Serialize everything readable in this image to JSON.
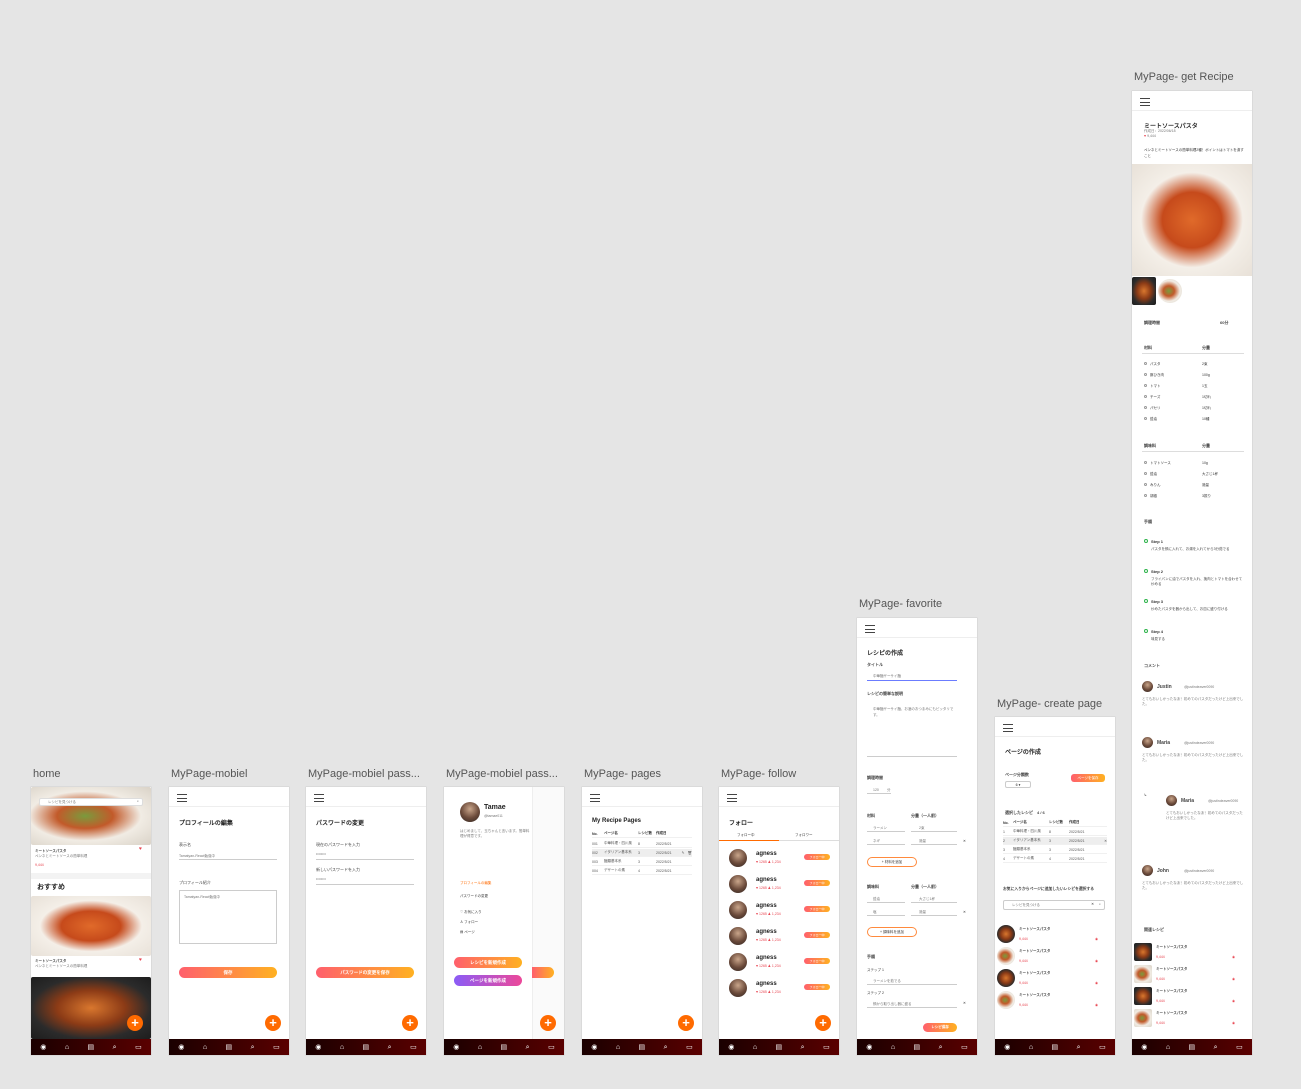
{
  "frames": {
    "home": {
      "label": "home",
      "search_placeholder": "レシピを見つける",
      "section_title": "おすすめ",
      "card_title": "ミートソースパスタ",
      "card_desc": "ペンネとミートソースの簡単料理",
      "likes": "9,444",
      "nav_icons": [
        "user-icon",
        "home-icon",
        "recipe-icon",
        "search-icon",
        "chat-icon"
      ]
    },
    "mobiel": {
      "label": "MyPage-mobiel",
      "title": "プロフィールの編集",
      "name_label": "表示名",
      "name_value": "Tamatyan-React勉強中",
      "bio_label": "プロフィール紹介",
      "bio_value": "Tamatyan-React勉強中",
      "save_label": "保存"
    },
    "password": {
      "label": "MyPage-mobiel pass...",
      "title": "パスワードの変更",
      "current_label": "現在のパスワードを入力",
      "new_label": "新しいパスワードを入力",
      "dots": "••••••••",
      "save_label": "パスワードの変更を保存"
    },
    "menu": {
      "label": "MyPage-mobiel pass...",
      "user_name": "Tamae",
      "user_id": "@tamae011",
      "bio": "はじめまして、玉ちゃんと言います。簡単料理が得意です。",
      "link_profile": "プロフィールの編集",
      "link_password": "パスワードの変更",
      "item_fav": "お気に入り",
      "item_follow": "フォロー",
      "item_page": "ページ",
      "btn_recipe": "レシピを新規作成",
      "btn_page": "ページを新規作成"
    },
    "pages": {
      "label": "MyPage- pages",
      "title": "My Recipe Pages",
      "headers": [
        "No.",
        "ページ名",
        "レシピ数",
        "作成日"
      ],
      "rows": [
        [
          "001",
          "中華料理・四川風",
          "8",
          "2022/5/21"
        ],
        [
          "002",
          "イタリアン基本系",
          "3",
          "2022/5/21"
        ],
        [
          "003",
          "麺類基本系",
          "3",
          "2022/5/21"
        ],
        [
          "004",
          "デザートの素",
          "4",
          "2022/5/21"
        ]
      ]
    },
    "follow": {
      "label": "MyPage- follow",
      "title": "フォロー",
      "tab_following": "フォロー中",
      "tab_followers": "フォロワー",
      "user": "agness",
      "stats": "♥ 1265  ♟ 1,234",
      "btn": "フォロー中",
      "count": 6
    },
    "favorite": {
      "label": "MyPage- favorite",
      "title": "レシピの作成",
      "title_label": "タイトル",
      "title_value": "中華麺ザーサイ麺",
      "desc_label": "レシピの簡単な説明",
      "desc_value": "中華麺ザーサイ麺、お酒のおつまみにもピッタリです。",
      "time_label": "調理時間",
      "time_value": "120",
      "time_unit": "分",
      "ing_label": "材料",
      "qty_label": "分量（一人前）",
      "ing_rows": [
        [
          "ラーメン",
          "2束"
        ],
        [
          "ネギ",
          "適量"
        ]
      ],
      "add_ing": "+ 材料を追加",
      "seas_label": "調味料",
      "seas_rows": [
        [
          "醤油",
          "大さじ1杯"
        ],
        [
          "塩",
          "適量"
        ]
      ],
      "add_seas": "+ 調味料を追加",
      "steps_label": "手順",
      "step1": "ステップ 1",
      "step1_text": "ラーメンを茹でる",
      "step2": "ステップ 2",
      "step2_text": "鍋から取り出し器に盛る",
      "save_label": "レシピ保存"
    },
    "create_page": {
      "label": "MyPage- create page",
      "title": "ページの作成",
      "category_label": "ページ分類数",
      "category_value": "6",
      "btn_label": "ページを保存",
      "selected_label": "選択したレシピ",
      "selected_count": "4 / 6",
      "headers": [
        "No.",
        "ページ名",
        "レシピ数",
        "作成日"
      ],
      "rows": [
        [
          "1",
          "中華料理・四川風",
          "8",
          "2022/5/21"
        ],
        [
          "2",
          "イタリアン基本系",
          "3",
          "2022/5/21"
        ],
        [
          "3",
          "麺類基本系",
          "3",
          "2022/5/21"
        ],
        [
          "4",
          "デザートの素",
          "4",
          "2022/5/21"
        ]
      ],
      "add_title": "お気に入りからページに追加したいレシピを選択する",
      "search_placeholder": "レシピを見つける",
      "card_title": "ミートソースパスタ",
      "likes": "9,444"
    },
    "get_recipe": {
      "label": "MyPage- get Recipe",
      "title": "ミートソースパスタ",
      "meta": "作成日：2022/06/18",
      "likes": "9,444",
      "desc": "ペンネとミートソースの簡単料理2種！ポイントはトマトを潰すこと",
      "time_label": "調理時間",
      "time_value": "60分",
      "ing_label": "材料",
      "qty_label": "分量",
      "ingredients": [
        [
          "パスタ",
          "2束"
        ],
        [
          "豚ひき肉",
          "100g"
        ],
        [
          "トマト",
          "1玉"
        ],
        [
          "チーズ",
          "1切れ"
        ],
        [
          "パセリ",
          "1切れ"
        ],
        [
          "醤油",
          "10種"
        ]
      ],
      "seas_label": "調味料",
      "seas_qty": "分量",
      "seasonings": [
        [
          "トマトソース",
          "10g"
        ],
        [
          "醤油",
          "大さじ1杯"
        ],
        [
          "みりん",
          "適量"
        ],
        [
          "胡椒",
          "3振り"
        ]
      ],
      "steps_label": "手順",
      "steps": [
        [
          "Step 1",
          "パスタを鍋に入れて、お湯を入れてから3分茹でる"
        ],
        [
          "Step 2",
          "フライパンに油でパスタを入れ、挽肉とトマトを合わせて炒める"
        ],
        [
          "Step 3",
          "炒めたパスタを器から出して、お皿に盛り付ける"
        ],
        [
          "Step 4",
          "味見する"
        ]
      ],
      "comments_label": "コメント",
      "comments": [
        [
          "Justin",
          "@justindeaver0090",
          "とてもおいしかったなあ！初めてのパスタだったけど上出来でした。"
        ],
        [
          "Maria",
          "@justindeaver0090",
          "とてもおいしかったなあ！初めてのパスタだったけど上出来でした。"
        ],
        [
          "Maria",
          "@justindeaver0090",
          "とてもおいしかったなあ！初めてのパスタだったけど上出来でした。"
        ],
        [
          "John",
          "@justindeaver0090",
          "とてもおいしかったなあ！初めてのパスタだったけど上出来でした。"
        ]
      ],
      "related_label": "関連レシピ",
      "related_title": "ミートソースパスタ",
      "related_likes": "9,444"
    }
  }
}
